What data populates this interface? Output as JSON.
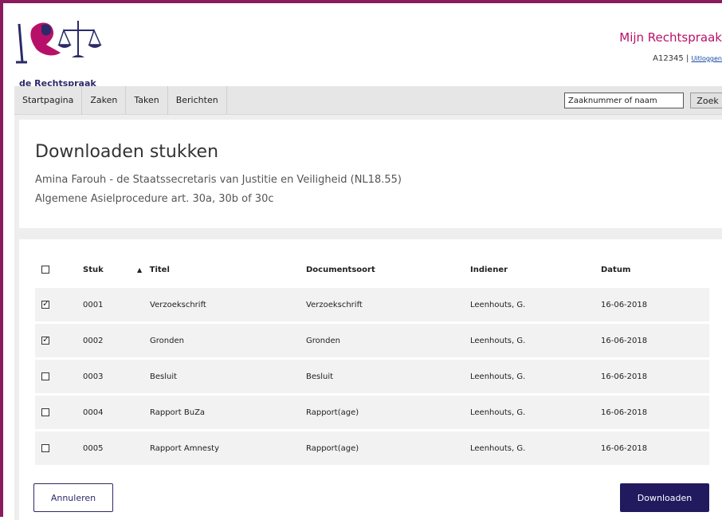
{
  "header": {
    "logo_text": "de Rechtspraak",
    "logo_icon": "justice-scales-logo",
    "site_title": "Mijn Rechtspraak",
    "user_id": "A12345",
    "separator": "|",
    "logout_label": "Uitloggen"
  },
  "nav": {
    "items": [
      {
        "label": "Startpagina"
      },
      {
        "label": "Zaken"
      },
      {
        "label": "Taken"
      },
      {
        "label": "Berichten"
      }
    ],
    "search": {
      "value": "Zaaknummer of naam",
      "button_label": "Zoek"
    }
  },
  "page": {
    "title": "Downloaden stukken",
    "subtitle1": "Amina Farouh - de Staatssecretaris van Justitie en Veiligheid (NL18.55)",
    "subtitle2": "Algemene Asielprocedure art. 30a, 30b of 30c"
  },
  "table": {
    "headers": {
      "stuk": "Stuk",
      "sort_indicator": "▲",
      "titel": "Titel",
      "documentsoort": "Documentsoort",
      "indiener": "Indiener",
      "datum": "Datum"
    },
    "header_checked": false,
    "rows": [
      {
        "checked": true,
        "stuk": "0001",
        "titel": "Verzoekschrift",
        "documentsoort": "Verzoekschrift",
        "indiener": "Leenhouts, G.",
        "datum": "16-06-2018"
      },
      {
        "checked": true,
        "stuk": "0002",
        "titel": "Gronden",
        "documentsoort": "Gronden",
        "indiener": "Leenhouts, G.",
        "datum": "16-06-2018"
      },
      {
        "checked": false,
        "stuk": "0003",
        "titel": "Besluit",
        "documentsoort": "Besluit",
        "indiener": "Leenhouts, G.",
        "datum": "16-06-2018"
      },
      {
        "checked": false,
        "stuk": "0004",
        "titel": "Rapport BuZa",
        "documentsoort": "Rapport(age)",
        "indiener": "Leenhouts, G.",
        "datum": "16-06-2018"
      },
      {
        "checked": false,
        "stuk": "0005",
        "titel": "Rapport Amnesty",
        "documentsoort": "Rapport(age)",
        "indiener": "Leenhouts, G.",
        "datum": "16-06-2018"
      }
    ]
  },
  "actions": {
    "cancel_label": "Annuleren",
    "download_label": "Downloaden"
  },
  "colors": {
    "brand_purple": "#8c1a5f",
    "brand_magenta": "#b8106a",
    "button_navy": "#221a5e"
  }
}
